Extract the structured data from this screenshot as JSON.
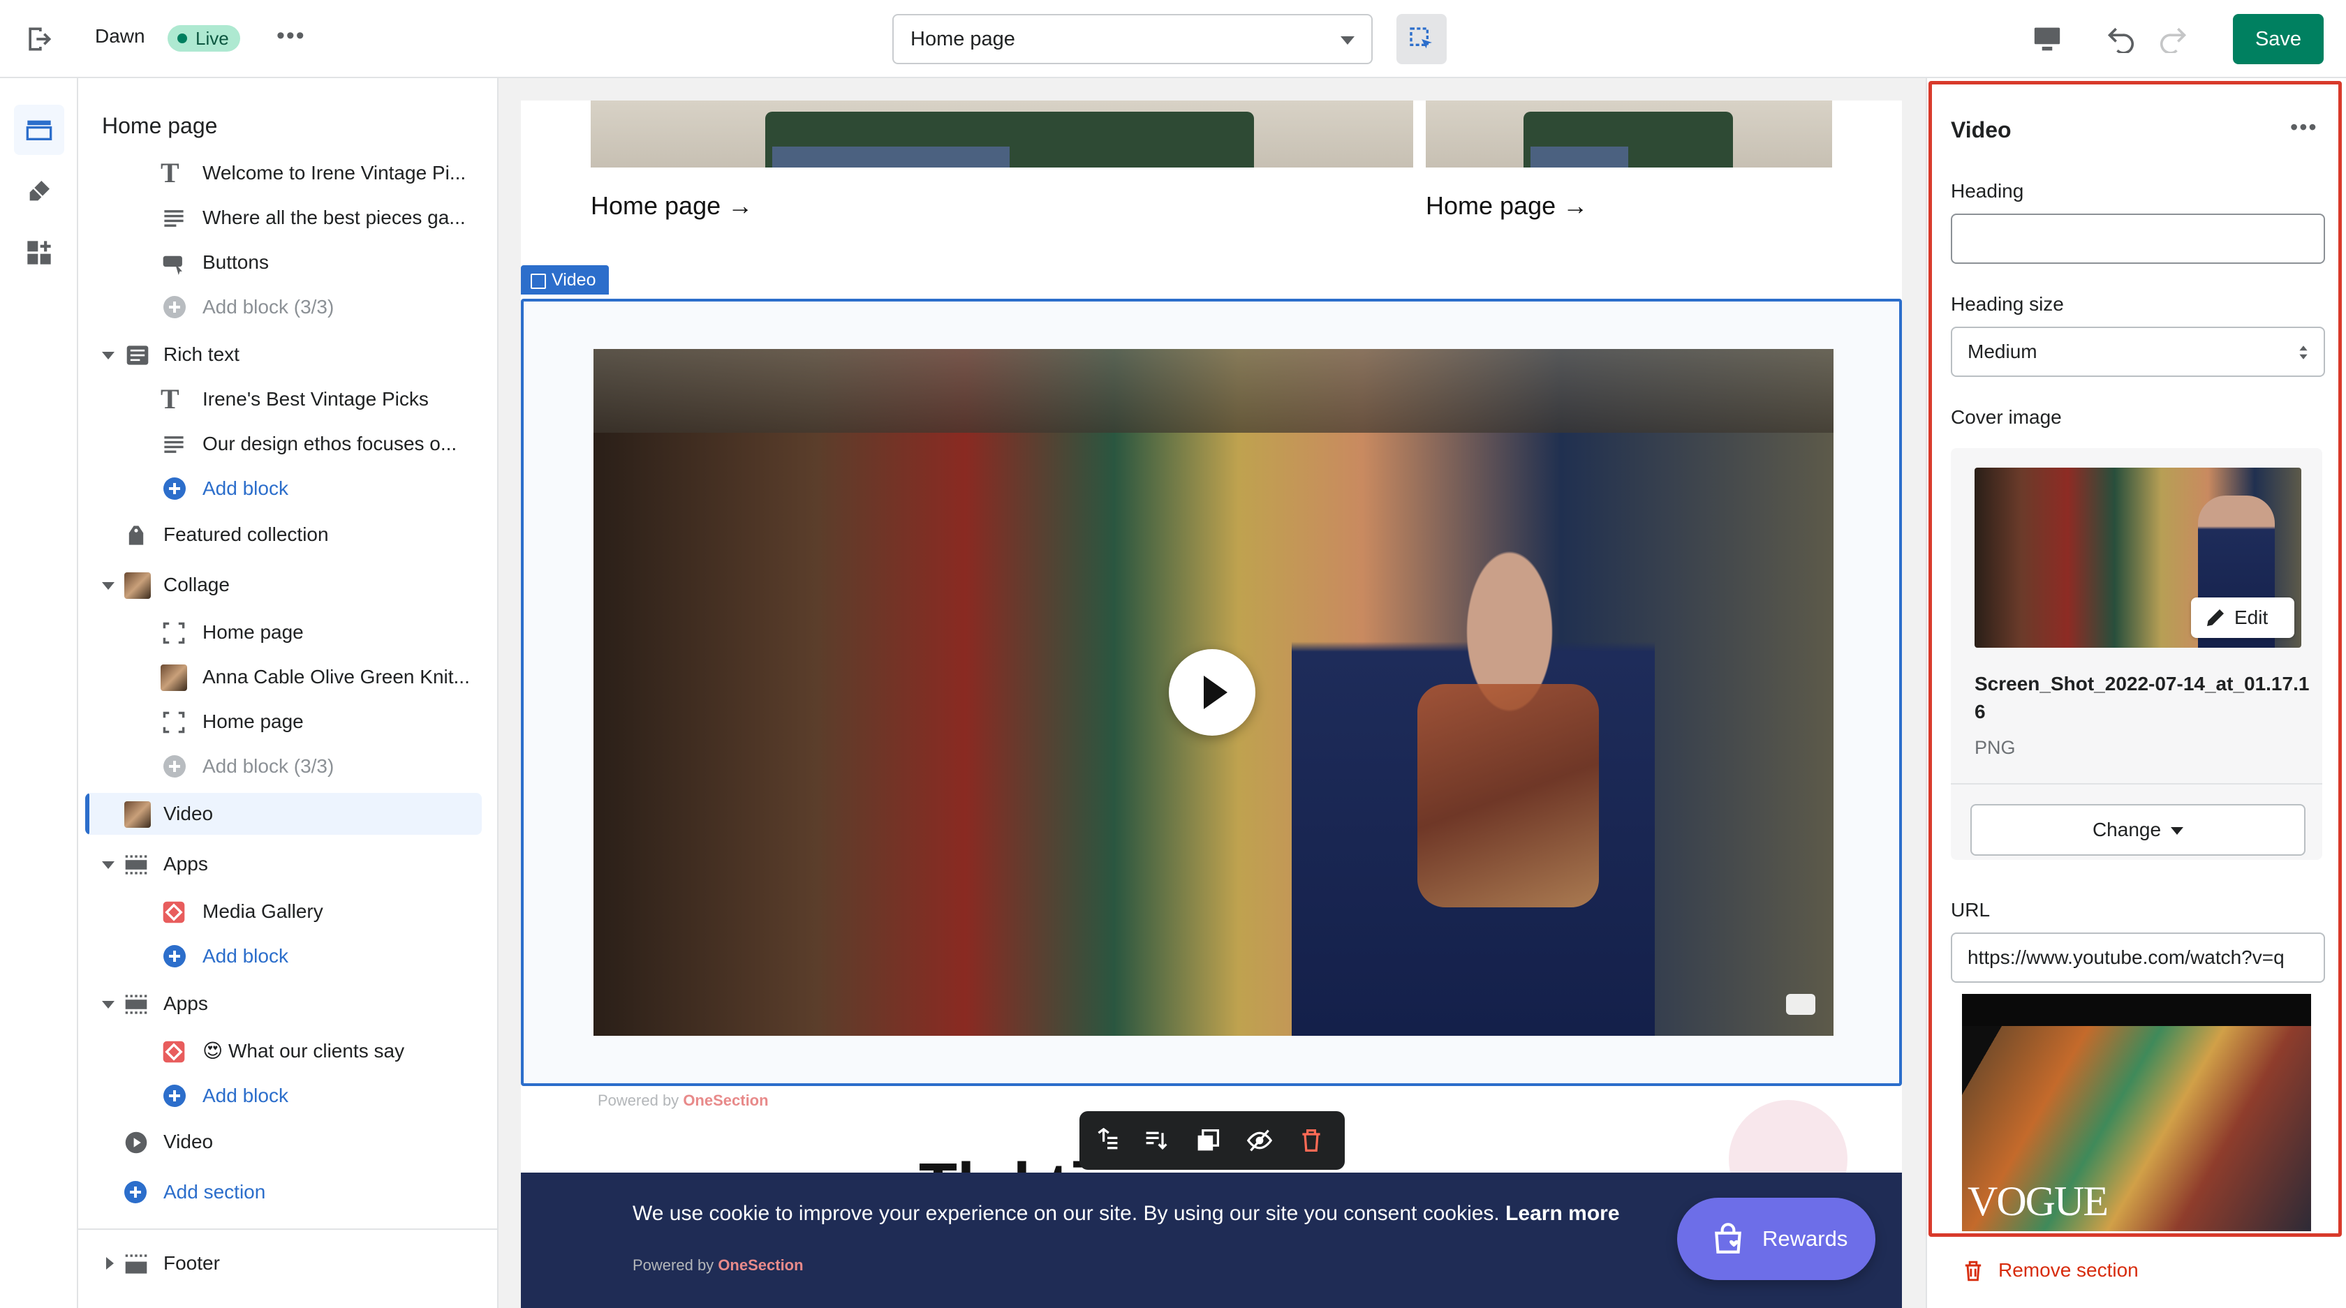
{
  "topbar": {
    "theme_name": "Dawn",
    "live_badge": "Live",
    "more": "•••",
    "template_select": "Home page",
    "save_label": "Save"
  },
  "sidebar": {
    "title": "Home page",
    "items": [
      {
        "label": "Welcome to Irene Vintage Pi..."
      },
      {
        "label": "Where all the best pieces ga..."
      },
      {
        "label": "Buttons"
      },
      {
        "label": "Add block (3/3)"
      },
      {
        "label": "Rich text"
      },
      {
        "label": "Irene's Best Vintage Picks"
      },
      {
        "label": "Our design ethos focuses o..."
      },
      {
        "label": "Add block"
      },
      {
        "label": "Featured collection"
      },
      {
        "label": "Collage"
      },
      {
        "label": "Home page"
      },
      {
        "label": "Anna Cable Olive Green Knit..."
      },
      {
        "label": "Home page"
      },
      {
        "label": "Add block (3/3)"
      },
      {
        "label": "Video"
      },
      {
        "label": "Apps"
      },
      {
        "label": "Media Gallery"
      },
      {
        "label": "Add block"
      },
      {
        "label": "Apps"
      },
      {
        "label": "😍 What our clients say"
      },
      {
        "label": "Add block"
      },
      {
        "label": "Video"
      },
      {
        "label": "Add section"
      },
      {
        "label": "Footer"
      }
    ]
  },
  "canvas": {
    "collage_link_1": "Home page →",
    "collage_link_2": "Home page →",
    "video_tag": "Video",
    "powered_prefix": "Powered by",
    "powered_brand": "OneSection",
    "cookie_text": "We use cookie to improve your experience on our site. By using our site you consent cookies.",
    "cookie_learn": "Learn more",
    "rewards_label": "Rewards",
    "behind_heading": "Th   l          ti"
  },
  "panel": {
    "title": "Video",
    "more": "•••",
    "heading_label": "Heading",
    "heading_value": "",
    "heading_size_label": "Heading size",
    "heading_size_value": "Medium",
    "cover_image_label": "Cover image",
    "edit_label": "Edit",
    "file_name": "Screen_Shot_2022-07-14_at_01.17.16",
    "file_type": "PNG",
    "change_label": "Change",
    "url_label": "URL",
    "url_value": "https://www.youtube.com/watch?v=q",
    "vogue_text": "VOGUE",
    "remove_label": "Remove section"
  },
  "colors": {
    "accent": "#2c6ecb",
    "save_green": "#008060",
    "highlight_red": "#d83a2b",
    "cookie_bg": "#1f2c55",
    "rewards": "#6d6ee8"
  }
}
